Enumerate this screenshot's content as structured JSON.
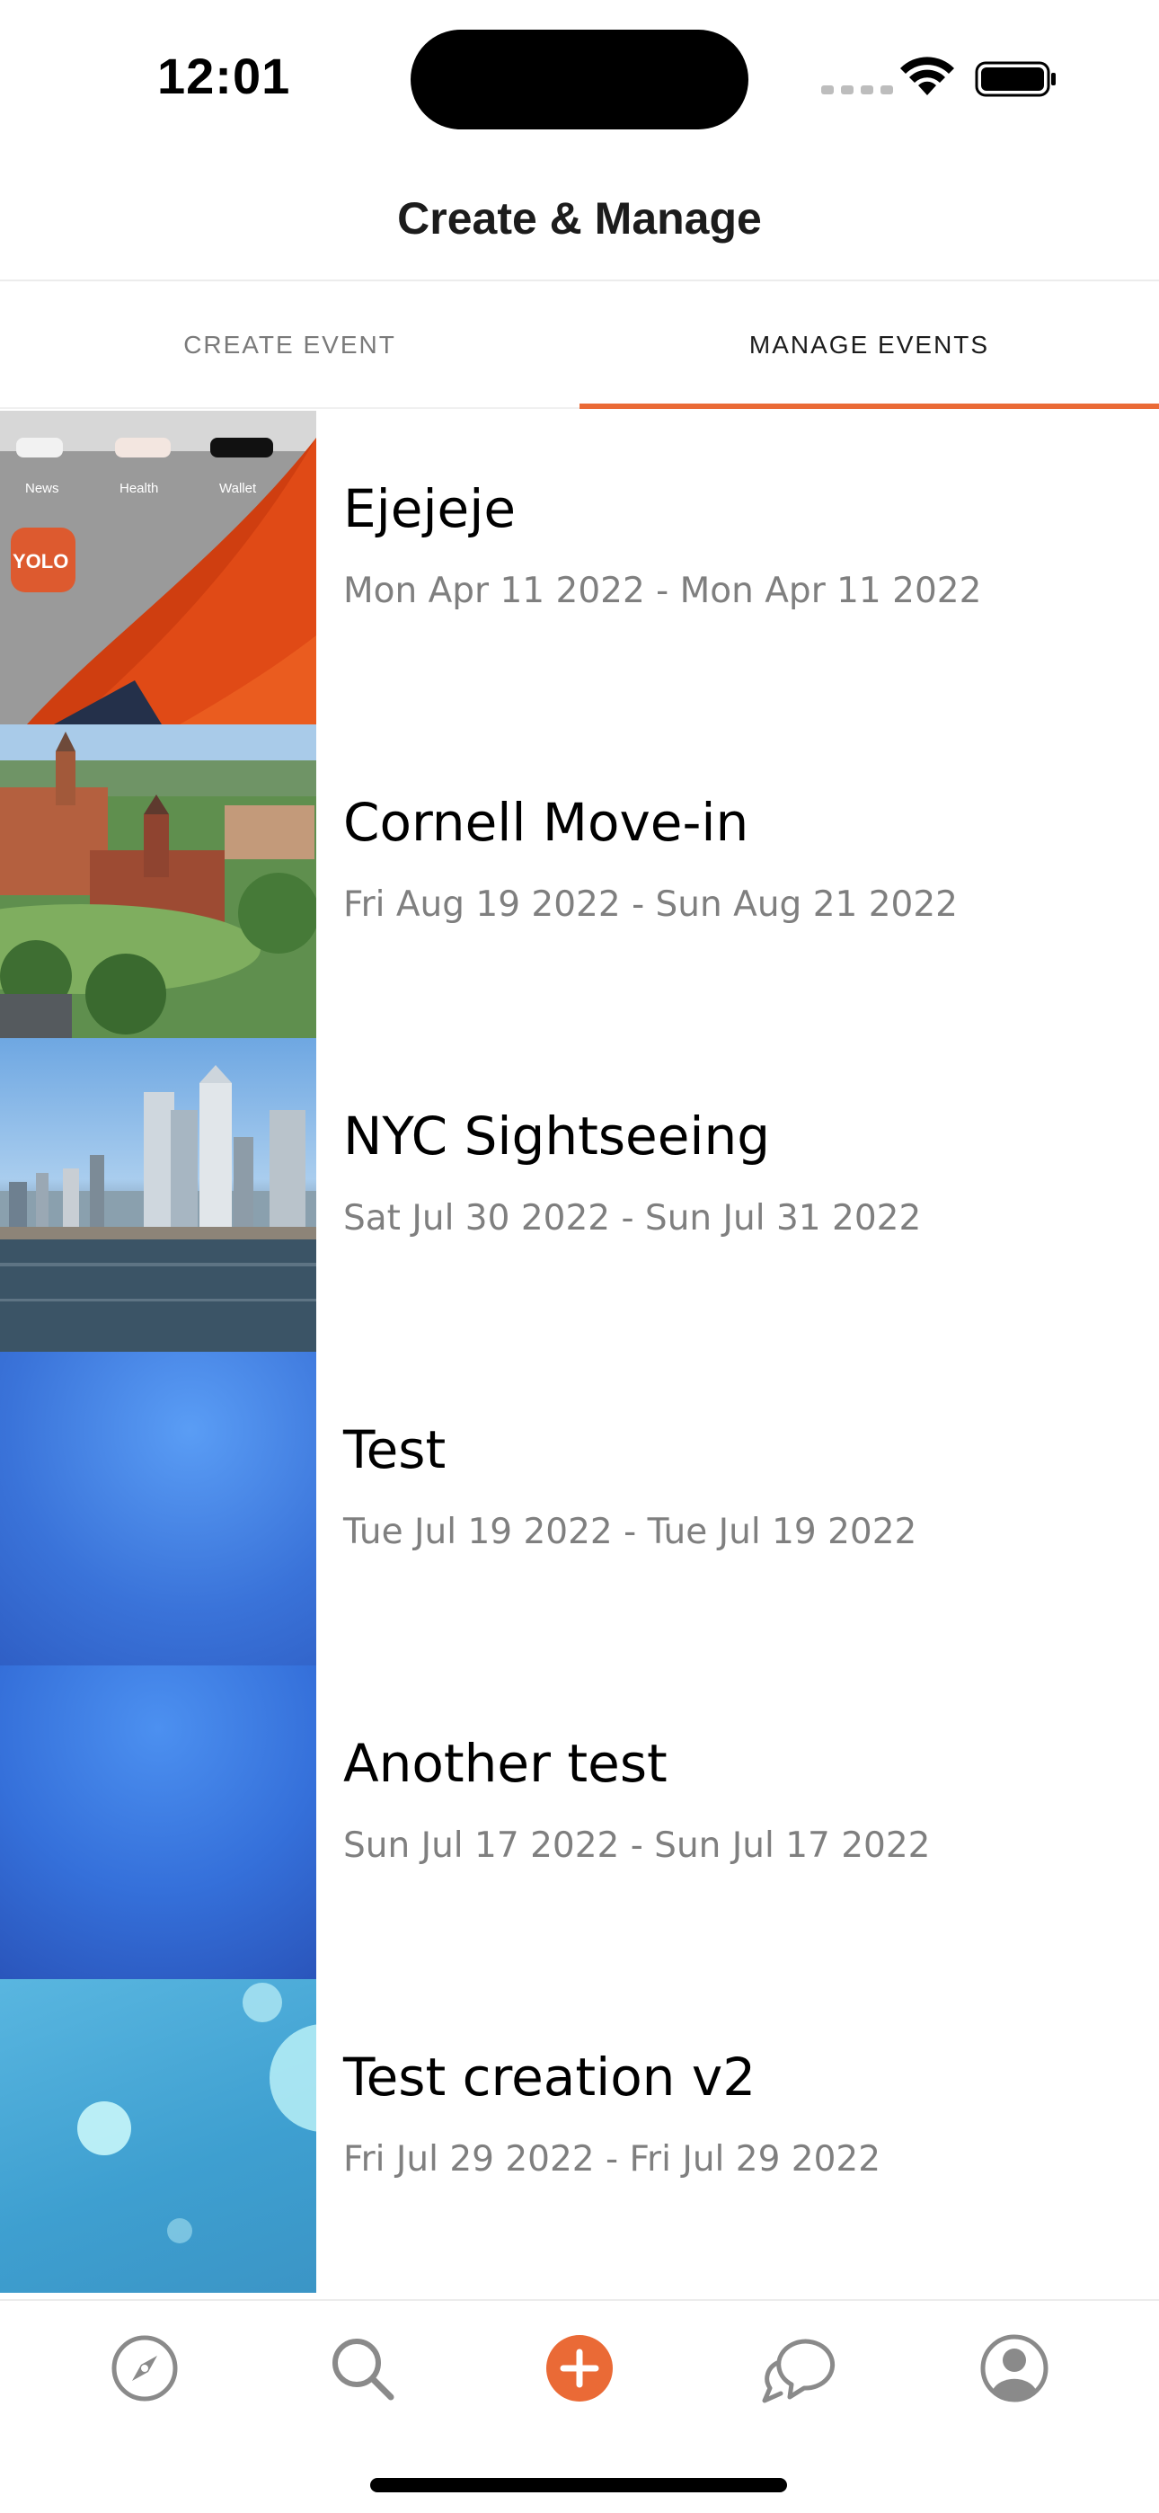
{
  "status_bar": {
    "time": "12:01"
  },
  "header": {
    "title": "Create & Manage"
  },
  "tabs": [
    {
      "label": "CREATE EVENT",
      "active": false
    },
    {
      "label": "MANAGE EVENTS",
      "active": true
    }
  ],
  "events": [
    {
      "name": "Ejejeje",
      "dates": "Mon Apr 11 2022 - Mon Apr 11 2022",
      "thumbnail": "phone-homescreen-photo"
    },
    {
      "name": "Cornell Move-in",
      "dates": "Fri Aug 19 2022 - Sun Aug 21 2022",
      "thumbnail": "campus-photo"
    },
    {
      "name": "NYC Sightseeing",
      "dates": "Sat Jul 30 2022 - Sun Jul 31 2022",
      "thumbnail": "city-skyline-photo"
    },
    {
      "name": "Test",
      "dates": "Tue Jul 19 2022 - Tue Jul 19 2022",
      "thumbnail": "blue-gradient"
    },
    {
      "name": "Another test",
      "dates": "Sun Jul 17 2022 - Sun Jul 17 2022",
      "thumbnail": "blue-gradient"
    },
    {
      "name": "Test creation v2",
      "dates": "Fri Jul 29 2022 - Fri Jul 29 2022",
      "thumbnail": "blue-bubbles"
    }
  ],
  "phone_thumbnail_text": {
    "news": "News",
    "health": "Health",
    "wallet": "Wallet",
    "app_badge": "YOLO"
  },
  "bottom_nav": [
    {
      "icon": "compass-icon"
    },
    {
      "icon": "search-icon"
    },
    {
      "icon": "add-circle-icon"
    },
    {
      "icon": "chat-bubbles-icon"
    },
    {
      "icon": "profile-icon"
    }
  ],
  "colors": {
    "accent": "#ea6a36",
    "inactive_icon": "#8a8a8a"
  }
}
